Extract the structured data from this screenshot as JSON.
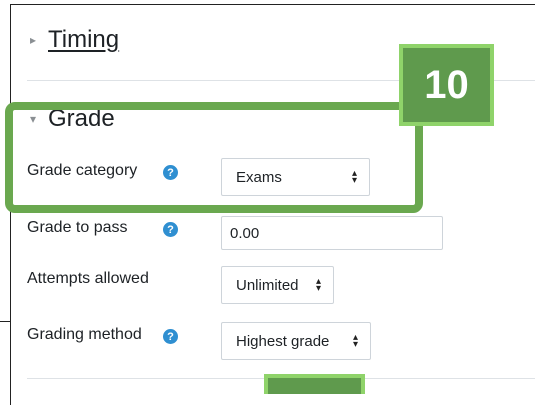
{
  "sections": {
    "timing": {
      "title": "Timing"
    },
    "grade": {
      "title": "Grade"
    }
  },
  "fields": {
    "grade_category": {
      "label": "Grade category",
      "value": "Exams"
    },
    "grade_to_pass": {
      "label": "Grade to pass",
      "value": "0.00"
    },
    "attempts_allowed": {
      "label": "Attempts allowed",
      "value": "Unlimited"
    },
    "grading_method": {
      "label": "Grading method",
      "value": "Highest grade"
    }
  },
  "annotation": {
    "step_number": "10"
  },
  "colors": {
    "highlight": "#6aa84f",
    "badge_fill": "#5f9a4d",
    "badge_border": "#8fd36a",
    "help_icon": "#2f8fd1"
  }
}
